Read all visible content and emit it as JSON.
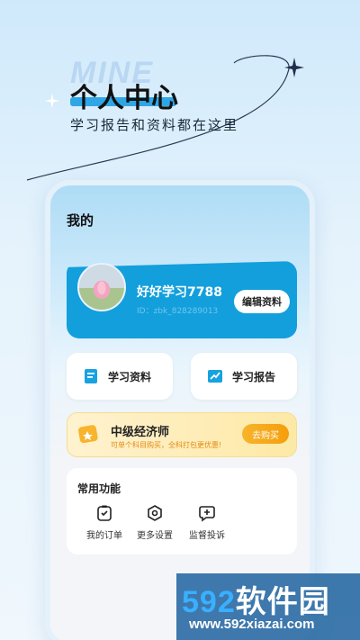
{
  "promo": {
    "watermark_word": "MINE",
    "title": "个人中心",
    "subtitle": "学习报告和资料都在这里"
  },
  "screen": {
    "title": "我的",
    "profile": {
      "nickname": "好好学习7788",
      "user_id": "ID：zbk_828289013",
      "edit_label": "编辑资料"
    },
    "quick_cards": [
      {
        "label": "学习资料",
        "icon": "document-icon"
      },
      {
        "label": "学习报告",
        "icon": "chart-icon"
      }
    ],
    "course": {
      "title": "中级经济师",
      "subtitle": "可单个科目购买，全科打包更优惠!",
      "buy_label": "去购买"
    },
    "functions": {
      "title": "常用功能",
      "items": [
        {
          "label": "我的订单",
          "icon": "order-icon"
        },
        {
          "label": "更多设置",
          "icon": "settings-icon"
        },
        {
          "label": "监督投诉",
          "icon": "complaint-icon"
        }
      ]
    }
  },
  "watermark": {
    "brand_number": "592",
    "brand_text": "软件园",
    "url": "www.592xiazai.com"
  },
  "colors": {
    "accent": "#129fdc",
    "course_bg": "#fde9a6",
    "buy_button": "#f5a314"
  }
}
